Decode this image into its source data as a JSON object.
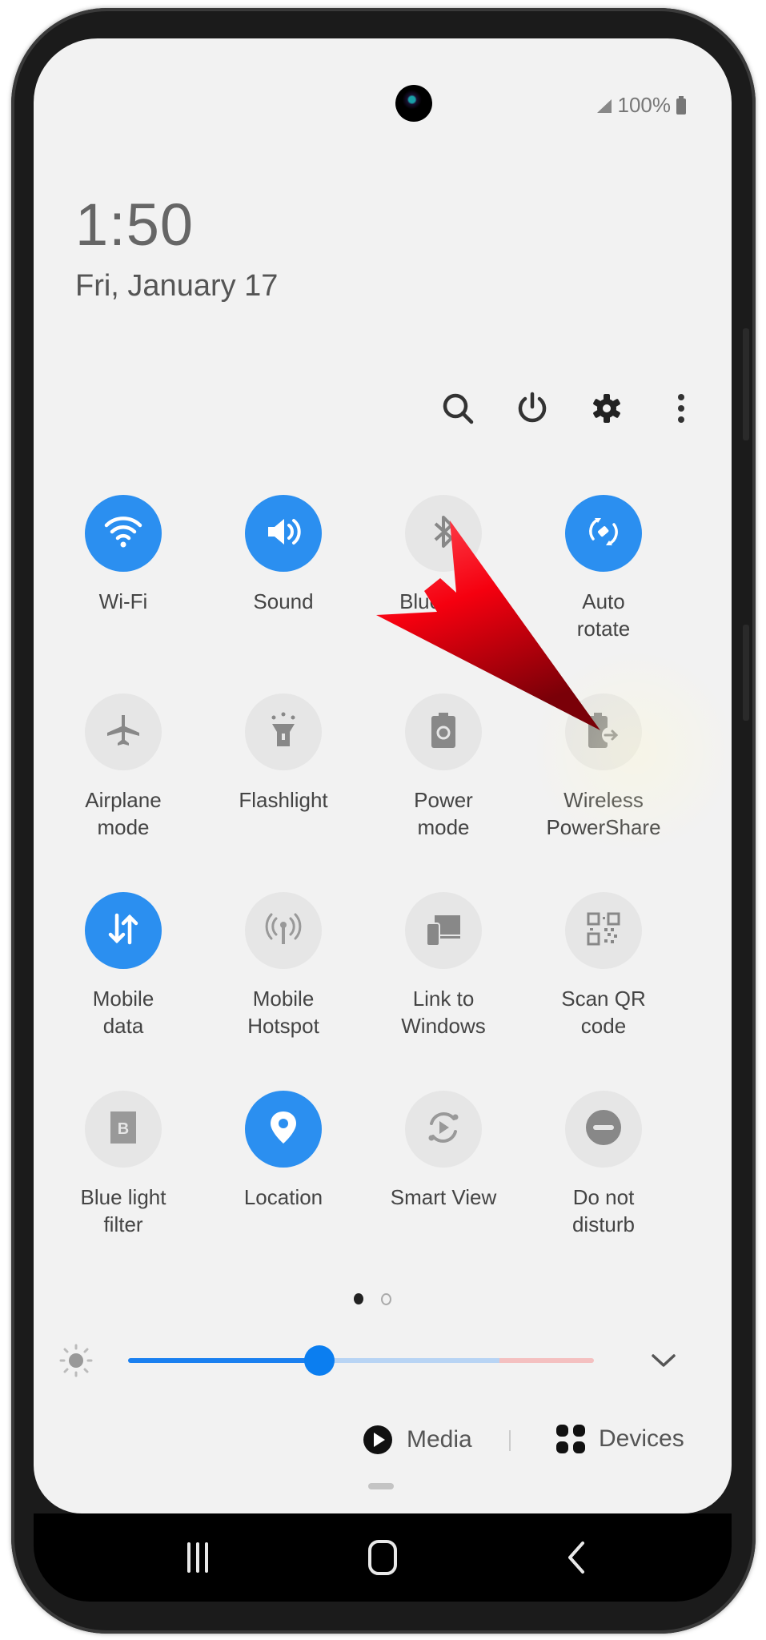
{
  "status_bar": {
    "battery_text": "100%",
    "signal_icon": "signal-icon",
    "battery_icon": "battery-icon"
  },
  "lock_info": {
    "time": "1:50",
    "date": "Fri, January 17"
  },
  "toolbar": {
    "items": [
      {
        "name": "search",
        "icon": "search-icon"
      },
      {
        "name": "power",
        "icon": "power-icon"
      },
      {
        "name": "settings",
        "icon": "gear-icon"
      },
      {
        "name": "more",
        "icon": "more-vertical-icon"
      }
    ]
  },
  "quick_settings": {
    "tiles": [
      {
        "label": "Wi-Fi",
        "icon": "wifi-icon",
        "on": true
      },
      {
        "label": "Sound",
        "icon": "sound-icon",
        "on": true
      },
      {
        "label": "Bluetooth",
        "icon": "bluetooth-icon",
        "on": false
      },
      {
        "label": "Auto\nrotate",
        "icon": "auto-rotate-icon",
        "on": true
      },
      {
        "label": "Airplane\nmode",
        "icon": "airplane-icon",
        "on": false
      },
      {
        "label": "Flashlight",
        "icon": "flashlight-icon",
        "on": false
      },
      {
        "label": "Power\nmode",
        "icon": "power-mode-icon",
        "on": false
      },
      {
        "label": "Wireless\nPowerShare",
        "icon": "wireless-powershare-icon",
        "on": false
      },
      {
        "label": "Mobile\ndata",
        "icon": "mobile-data-icon",
        "on": true
      },
      {
        "label": "Mobile\nHotspot",
        "icon": "hotspot-icon",
        "on": false
      },
      {
        "label": "Link to\nWindows",
        "icon": "link-to-windows-icon",
        "on": false
      },
      {
        "label": "Scan QR\ncode",
        "icon": "qr-code-icon",
        "on": false
      },
      {
        "label": "Blue light\nfilter",
        "icon": "blue-light-filter-icon",
        "on": false
      },
      {
        "label": "Location",
        "icon": "location-icon",
        "on": true
      },
      {
        "label": "Smart View",
        "icon": "smart-view-icon",
        "on": false
      },
      {
        "label": "Do not\ndisturb",
        "icon": "do-not-disturb-icon",
        "on": false
      }
    ],
    "page_indicator": {
      "current": 1,
      "total": 2
    }
  },
  "brightness": {
    "value_fraction": 0.41,
    "icon": "brightness-icon",
    "expand_icon": "chevron-down-icon"
  },
  "media_devices": {
    "media_label": "Media",
    "devices_label": "Devices"
  },
  "nav_bar": {
    "recents": "recents-icon",
    "home": "home-icon",
    "back": "back-icon"
  },
  "colors": {
    "accent": "#2b8ff0",
    "tile_off": "#e6e6e6",
    "annotation_arrow": "#ff0010"
  }
}
